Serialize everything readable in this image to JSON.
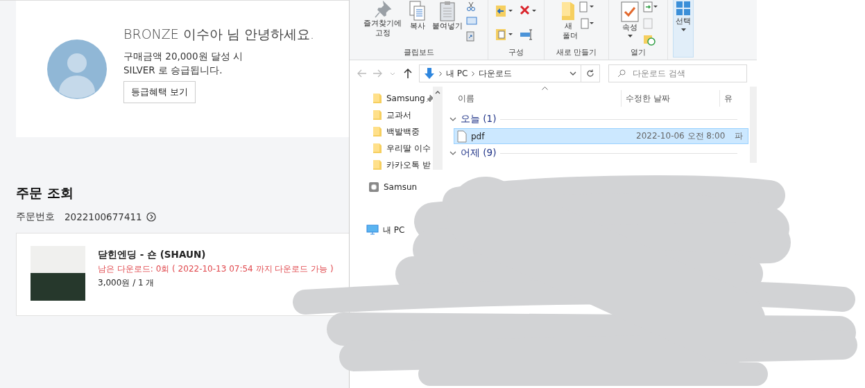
{
  "member": {
    "title": "BRONZE 이수아 님 안녕하세요.",
    "message_lines": [
      "구매금액 20,000원 달성 시",
      "SILVER 로 승급됩니다."
    ],
    "benefits_button": "등급혜택 보기"
  },
  "orders": {
    "title": "주문 조회",
    "number_label": "주문번호",
    "number": "2022100677411",
    "items": [
      {
        "title": "닫힌엔딩 - 숀 (SHAUN)",
        "download_info": "남은 다운로드: 0회 ( 2022-10-13 07:54 까지 다운로드 가능 )",
        "price": "3,000원 / 1 개"
      }
    ]
  },
  "explorer": {
    "ribbon": {
      "groups": [
        {
          "label": "클립보드",
          "kind": "clipboard",
          "buttons": [
            {
              "label": "즐겨찾기에 고정",
              "highlighted": false
            },
            {
              "label": "복사",
              "highlighted": false
            },
            {
              "label": "붙여넣기",
              "highlighted": false
            }
          ]
        },
        {
          "label": "구성",
          "kind": "organize"
        },
        {
          "label": "새로 만들기",
          "kind": "new",
          "buttons": [
            {
              "label": "새 폴더",
              "highlighted": false
            }
          ]
        },
        {
          "label": "열기",
          "kind": "open",
          "buttons": [
            {
              "label": "속성",
              "highlighted": false
            }
          ]
        },
        {
          "kind": "select",
          "buttons": [
            {
              "label": "선택",
              "highlighted": true
            }
          ]
        }
      ]
    },
    "address": {
      "path": [
        "내 PC",
        "다운로드"
      ],
      "search_placeholder": "다운로드 검색"
    },
    "nav_items": [
      {
        "label": "Samsung",
        "kind": "folder",
        "pinned": true
      },
      {
        "label": "교과서",
        "kind": "folder"
      },
      {
        "label": "백발백중",
        "kind": "folder"
      },
      {
        "label": "우리딸 이수",
        "kind": "folder"
      },
      {
        "label": "카카오톡 받",
        "kind": "folder"
      },
      {
        "label": "Samsun",
        "kind": "drive"
      },
      {
        "label": "내 PC",
        "kind": "pc"
      }
    ],
    "columns": [
      "이름",
      "수정한 날짜",
      "유"
    ],
    "groups": [
      {
        "label": "오늘 (1)",
        "expanded": true,
        "files": [
          {
            "name": "pdf",
            "date": "2022-10-06 오전 8:00",
            "type": "파",
            "selected": true
          }
        ]
      },
      {
        "label": "어제 (9)",
        "expanded": true
      }
    ]
  }
}
